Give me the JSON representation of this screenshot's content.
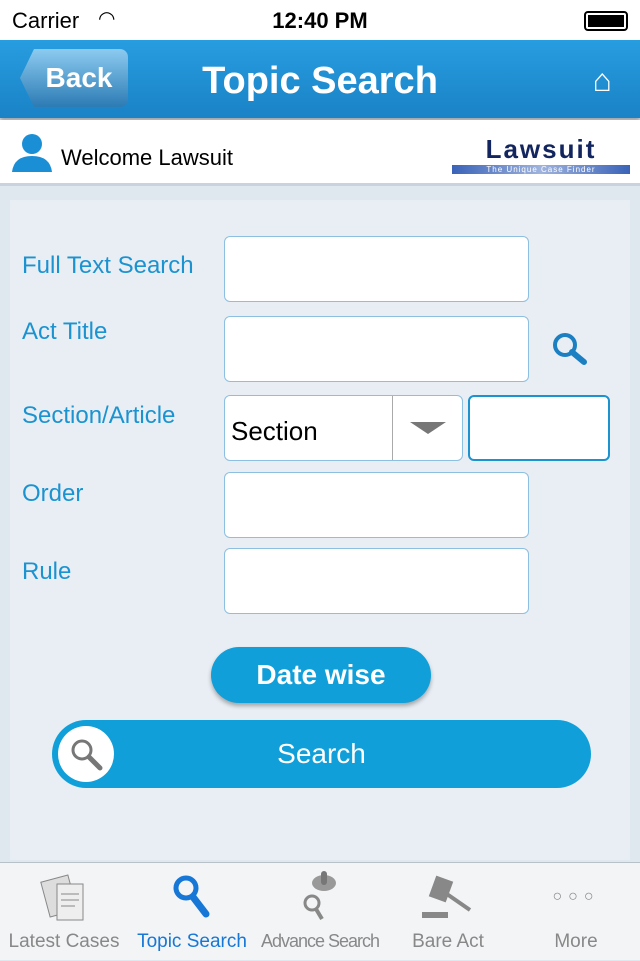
{
  "status": {
    "carrier": "Carrier",
    "time": "12:40 PM"
  },
  "nav": {
    "back": "Back",
    "title": "Topic Search"
  },
  "welcome": {
    "text": "Welcome Lawsuit",
    "logo_main": "Lawsuit",
    "logo_tag": "The Unique Case Finder"
  },
  "form": {
    "full_text_label": "Full Text Search",
    "full_text_value": "",
    "act_title_label": "Act Title",
    "act_title_value": "",
    "section_label": "Section/Article",
    "section_select": "Section",
    "section_value": "",
    "order_label": "Order",
    "order_value": "",
    "rule_label": "Rule",
    "rule_value": ""
  },
  "buttons": {
    "date_wise": "Date wise",
    "search": "Search"
  },
  "tabs": [
    {
      "label": "Latest Cases",
      "icon": "documents-icon"
    },
    {
      "label": "Topic Search",
      "icon": "search-icon",
      "active": true
    },
    {
      "label": "Advance Search",
      "icon": "advance-search-icon"
    },
    {
      "label": "Bare Act",
      "icon": "gavel-icon"
    },
    {
      "label": "More",
      "icon": "more-icon"
    }
  ],
  "colors": {
    "accent": "#1b93d0",
    "nav": "#1f8fd4",
    "active_tab": "#1677d6"
  }
}
